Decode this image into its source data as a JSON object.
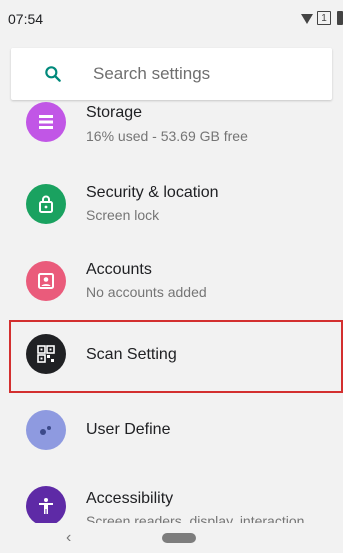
{
  "status_bar": {
    "time": "07:54",
    "sim_label": "1"
  },
  "search": {
    "placeholder": "Search settings"
  },
  "items": [
    {
      "title": "Storage",
      "subtitle": "16% used - 53.69 GB free",
      "icon": "storage-icon",
      "color": "#c156e6"
    },
    {
      "title": "Security & location",
      "subtitle": "Screen lock",
      "icon": "lock-icon",
      "color": "#1aa260"
    },
    {
      "title": "Accounts",
      "subtitle": "No accounts added",
      "icon": "account-icon",
      "color": "#ea5b7b"
    },
    {
      "title": "Scan Setting",
      "subtitle": "",
      "icon": "qr-scan-icon",
      "color": "#202124"
    },
    {
      "title": "User Define",
      "subtitle": "",
      "icon": "user-define-icon",
      "color": "#8e9ae0"
    },
    {
      "title": "Accessibility",
      "subtitle": "Screen readers, display, interaction",
      "icon": "accessibility-icon",
      "color": "#5e2aa6"
    }
  ],
  "colors": {
    "accent": "#00897b",
    "highlight": "#d32f2f"
  },
  "nav": {
    "back_glyph": "‹"
  }
}
